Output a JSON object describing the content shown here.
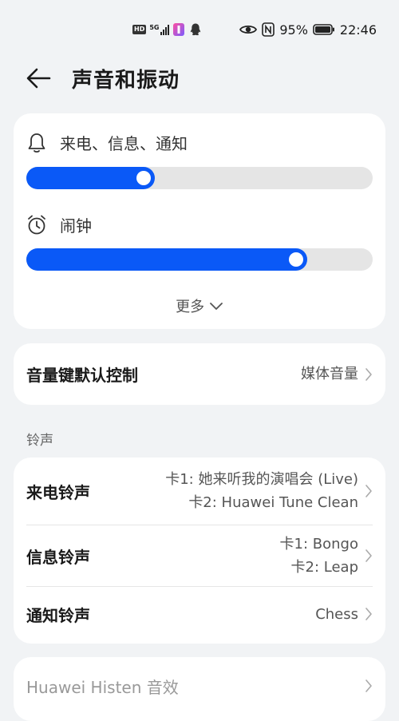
{
  "status_bar": {
    "hd": "HD",
    "network": "5G",
    "battery_percent": "95%",
    "time": "22:46"
  },
  "header": {
    "title": "声音和振动"
  },
  "volume": {
    "ringtone_label": "来电、信息、通知",
    "ringtone_level": 0.37,
    "alarm_label": "闹钟",
    "alarm_level": 0.81,
    "more_label": "更多"
  },
  "volume_key": {
    "title": "音量键默认控制",
    "value": "媒体音量"
  },
  "ringtone_section": {
    "label": "铃声",
    "items": [
      {
        "title": "来电铃声",
        "line1": "卡1: 她来听我的演唱会 (Live)",
        "line2": "卡2: Huawei Tune Clean"
      },
      {
        "title": "信息铃声",
        "line1": "卡1: Bongo",
        "line2": "卡2: Leap"
      },
      {
        "title": "通知铃声",
        "line1": "Chess"
      }
    ]
  },
  "histen": {
    "title": "Huawei Histen 音效"
  },
  "colors": {
    "accent": "#0a59f7",
    "background": "#f1f3f5",
    "card": "#ffffff"
  }
}
